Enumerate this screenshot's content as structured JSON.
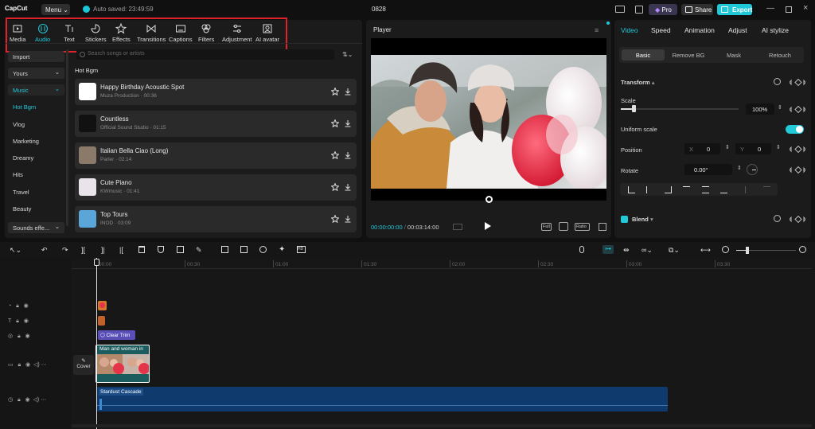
{
  "app": {
    "name": "CapCut",
    "menu_label": "Menu",
    "autosave_text": "Auto saved: 23:49:59",
    "project_title": "0828"
  },
  "header": {
    "pro_label": "Pro",
    "share_label": "Share",
    "export_label": "Export"
  },
  "toolbar": {
    "items": [
      {
        "label": "Media",
        "icon": "media-icon"
      },
      {
        "label": "Audio",
        "icon": "audio-icon",
        "active": true
      },
      {
        "label": "Text",
        "icon": "text-icon"
      },
      {
        "label": "Stickers",
        "icon": "stickers-icon"
      },
      {
        "label": "Effects",
        "icon": "effects-icon"
      },
      {
        "label": "Transitions",
        "icon": "transitions-icon"
      },
      {
        "label": "Captions",
        "icon": "captions-icon"
      },
      {
        "label": "Filters",
        "icon": "filters-icon"
      },
      {
        "label": "Adjustment",
        "icon": "adjustment-icon"
      },
      {
        "label": "AI avatar",
        "icon": "ai-avatar-icon"
      }
    ]
  },
  "sidebar": {
    "items": [
      "Import",
      "Yours",
      "Music",
      "Hot Bgm",
      "Vlog",
      "Marketing",
      "Dreamy",
      "Hits",
      "Travel",
      "Beauty",
      "Sounds effe..."
    ]
  },
  "audio": {
    "search_placeholder": "Search songs or artists",
    "section_title": "Hot Bgm",
    "tracks": [
      {
        "name": "Happy Birthday Acoustic Spot",
        "meta": "Muza Production · 00:36"
      },
      {
        "name": "Countless",
        "meta": "Official Sound Studio · 01:15"
      },
      {
        "name": "Italian Bella Ciao (Long)",
        "meta": "Parler · 02:14"
      },
      {
        "name": "Cute Piano",
        "meta": "KWmusic · 01:41"
      },
      {
        "name": "Top Tours",
        "meta": "INOD · 03:09"
      }
    ]
  },
  "player": {
    "title": "Player",
    "current_time": "00:00:00:00",
    "total_time": "00:03:14:00",
    "full_label": "Full",
    "ratio_label": "Ratio"
  },
  "properties": {
    "tabs": [
      "Video",
      "Speed",
      "Animation",
      "Adjust",
      "AI stylize"
    ],
    "subtabs": [
      "Basic",
      "Remove BG",
      "Mask",
      "Retouch"
    ],
    "transform_title": "Transform",
    "scale_label": "Scale",
    "scale_value": "100%",
    "scale_fraction": 0.11,
    "uniform_scale_label": "Uniform scale",
    "uniform_scale_on": true,
    "position_label": "Position",
    "pos_x_label": "X",
    "pos_x_value": "0",
    "pos_y_label": "Y",
    "pos_y_value": "0",
    "rotate_label": "Rotate",
    "rotate_value": "0.00°",
    "blend_label": "Blend"
  },
  "timeline": {
    "ruler": [
      "00:00",
      "00:30",
      "01:00",
      "01:30",
      "02:00",
      "02:30",
      "03:00",
      "03:30"
    ],
    "clear_trim_label": "Clear Trim",
    "video_clip_label": "Man and woman in",
    "cover_label": "Cover",
    "audio_clip_label": "Stardust Cascade"
  },
  "colors": {
    "accent": "#22c9d9",
    "highlight_box": "#e2222a",
    "audio_clip": "#0f3a6e",
    "video_clip": "#1b5c5e",
    "text_clip": "#5a4fb8"
  }
}
